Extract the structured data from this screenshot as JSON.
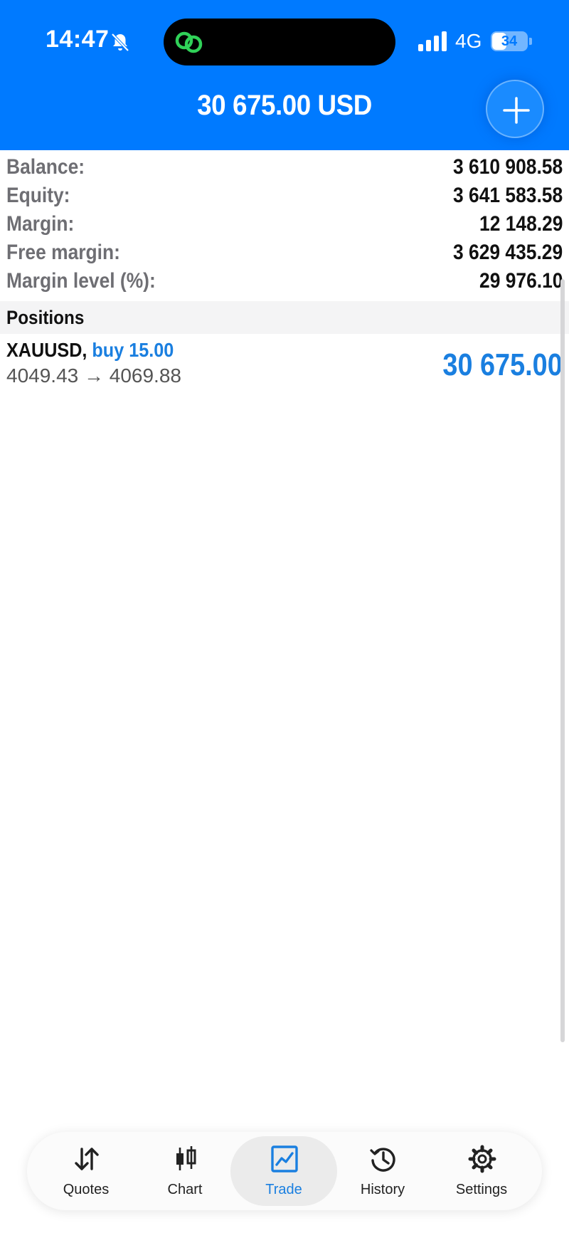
{
  "status_bar": {
    "time": "14:47",
    "network": "4G",
    "battery": "34",
    "icons": [
      "bell-slash-icon",
      "link-icon",
      "signal-icon",
      "battery-icon"
    ]
  },
  "header": {
    "title": "30 675.00 USD",
    "add_icon": "plus-icon"
  },
  "account": {
    "balance_label": "Balance:",
    "balance": "3 610 908.58",
    "equity_label": "Equity:",
    "equity": "3 641 583.58",
    "margin_label": "Margin:",
    "margin": "12 148.29",
    "free_margin_label": "Free margin:",
    "free_margin": "3 629 435.29",
    "margin_level_label": "Margin level (%):",
    "margin_level": "29 976.10"
  },
  "positions": {
    "header": "Positions",
    "items": [
      {
        "symbol": "XAUUSD,",
        "side": "buy 15.00",
        "prices": "4049.43 → 4069.88",
        "profit": "30 675.00"
      }
    ]
  },
  "tabbar": {
    "active": "Trade",
    "tabs": [
      {
        "label": "Quotes",
        "icon": "arrows-up-down-icon"
      },
      {
        "label": "Chart",
        "icon": "candlestick-icon"
      },
      {
        "label": "Trade",
        "icon": "trade-chart-icon"
      },
      {
        "label": "History",
        "icon": "history-clock-icon"
      },
      {
        "label": "Settings",
        "icon": "gear-icon"
      }
    ]
  },
  "colors": {
    "header_bg": "#007aff",
    "accent": "#1a7fe0",
    "island_icon": "#30d158"
  }
}
